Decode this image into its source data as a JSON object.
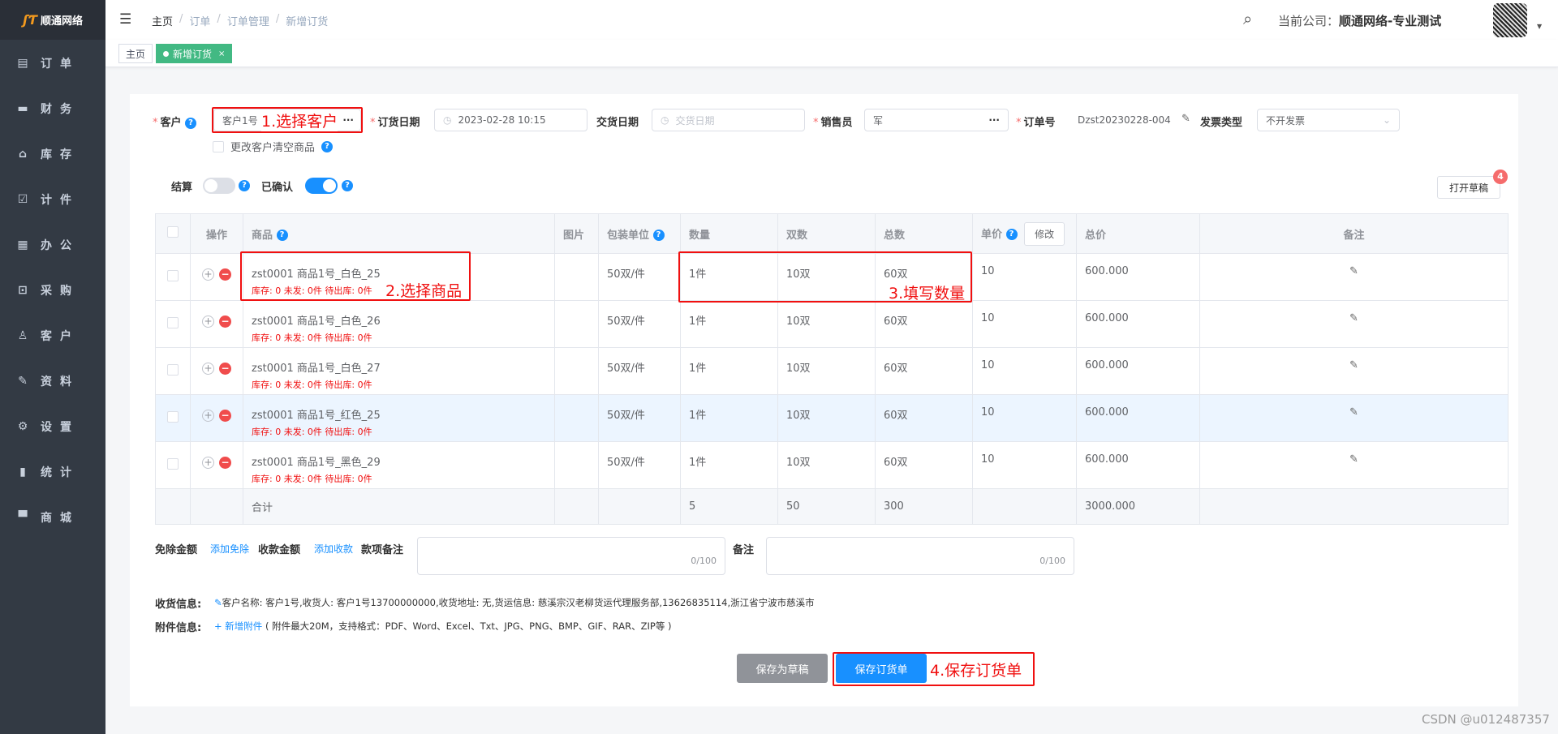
{
  "brand": {
    "name": "顺通网络",
    "mark": "ST"
  },
  "sidebar": {
    "items": [
      {
        "label": "订单",
        "icon": "order-icon",
        "glyph": "▤"
      },
      {
        "label": "财务",
        "icon": "wallet-icon",
        "glyph": "▬"
      },
      {
        "label": "库存",
        "icon": "home-icon",
        "glyph": "⌂"
      },
      {
        "label": "计件",
        "icon": "clipboard-check-icon",
        "glyph": "☑"
      },
      {
        "label": "办公",
        "icon": "calendar-icon",
        "glyph": "▦"
      },
      {
        "label": "采购",
        "icon": "box-icon",
        "glyph": "⊡"
      },
      {
        "label": "客户",
        "icon": "user-icon",
        "glyph": "♙"
      },
      {
        "label": "资料",
        "icon": "pencil-icon",
        "glyph": "✎"
      },
      {
        "label": "设置",
        "icon": "gear-icon",
        "glyph": "⚙"
      },
      {
        "label": "统计",
        "icon": "bar-chart-icon",
        "glyph": "▮"
      },
      {
        "label": "商城",
        "icon": "shop-icon",
        "glyph": "▀"
      }
    ]
  },
  "header": {
    "breadcrumb": [
      "主页",
      "订单",
      "订单管理",
      "新增订货"
    ],
    "sep": "/",
    "company_label": "当前公司：",
    "company_name": "顺通网络-专业测试"
  },
  "tabs": [
    {
      "label": "主页"
    },
    {
      "label": "新增订货",
      "close": "×"
    }
  ],
  "form": {
    "customer_label": "客户",
    "customer_value": "客户1号",
    "customer_more": "···",
    "order_date_label": "订货日期",
    "order_date_value": "2023-02-28 10:15",
    "delivery_date_label": "交货日期",
    "delivery_date_placeholder": "交货日期",
    "salesperson_label": "销售员",
    "salesperson_value": "军",
    "salesperson_more": "···",
    "order_no_label": "订单号",
    "order_no_value": "Dzst20230228-004",
    "invoice_label": "发票类型",
    "invoice_value": "不开发票",
    "clear_on_change_label": "更改客户清空商品",
    "settle_label": "结算",
    "settle_on": false,
    "confirmed_label": "已确认",
    "confirmed_on": true,
    "open_draft_label": "打开草稿",
    "draft_count": "4"
  },
  "annotations": {
    "step1": "1.选择客户",
    "step2": "2.选择商品",
    "step3": "3.填写数量",
    "step4": "4.保存订货单"
  },
  "table": {
    "headers": {
      "ops": "操作",
      "product": "商品",
      "image": "图片",
      "pack": "包装单位",
      "qty": "数量",
      "pairs": "双数",
      "total_pairs": "总数",
      "price": "单价",
      "modify": "修改",
      "amount": "总价",
      "remark": "备注"
    },
    "rows": [
      {
        "product": "zst0001 商品1号_白色_25",
        "stock": "库存: 0 未发: 0件 待出库: 0件",
        "pack": "50双/件",
        "qty": "1件",
        "pairs": "10双",
        "total": "60双",
        "price": "10",
        "amount": "600.000"
      },
      {
        "product": "zst0001 商品1号_白色_26",
        "stock": "库存: 0 未发: 0件 待出库: 0件",
        "pack": "50双/件",
        "qty": "1件",
        "pairs": "10双",
        "total": "60双",
        "price": "10",
        "amount": "600.000"
      },
      {
        "product": "zst0001 商品1号_白色_27",
        "stock": "库存: 0 未发: 0件 待出库: 0件",
        "pack": "50双/件",
        "qty": "1件",
        "pairs": "10双",
        "total": "60双",
        "price": "10",
        "amount": "600.000"
      },
      {
        "product": "zst0001 商品1号_红色_25",
        "stock": "库存: 0 未发: 0件 待出库: 0件",
        "pack": "50双/件",
        "qty": "1件",
        "pairs": "10双",
        "total": "60双",
        "price": "10",
        "amount": "600.000"
      },
      {
        "product": "zst0001 商品1号_黑色_29",
        "stock": "库存: 0 未发: 0件 待出库: 0件",
        "pack": "50双/件",
        "qty": "1件",
        "pairs": "10双",
        "total": "60双",
        "price": "10",
        "amount": "600.000"
      }
    ],
    "totals": {
      "label": "合计",
      "qty": "5",
      "pairs": "50",
      "total": "300",
      "amount": "3000.000"
    }
  },
  "bottom": {
    "discount_label": "免除金额",
    "discount_link": "添加免除",
    "receipt_label": "收款金额",
    "receipt_link": "添加收款",
    "payment_note_label": "款项备注",
    "payment_note_count": "0/100",
    "remark_label": "备注",
    "remark_count": "0/100",
    "shipping_label": "收货信息:",
    "shipping_value": "客户名称: 客户1号,收货人: 客户1号13700000000,收货地址: 无,货运信息: 慈溪宗汉老柳货运代理服务部,13626835114,浙江省宁波市慈溪市",
    "attach_label": "附件信息:",
    "attach_link": "+ 新增附件",
    "attach_hint": "( 附件最大20M，支持格式：PDF、Word、Excel、Txt、JPG、PNG、BMP、GIF、RAR、ZIP等 )",
    "save_draft": "保存为草稿",
    "save_order": "保存订货单"
  },
  "watermark": "CSDN @u012487357"
}
